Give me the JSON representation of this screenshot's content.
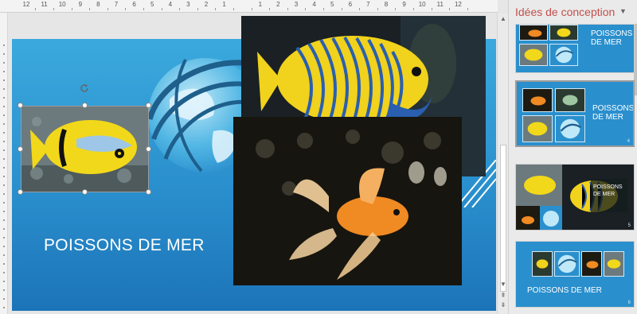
{
  "ruler": {
    "ticks": [
      "12",
      "11",
      "10",
      "9",
      "8",
      "7",
      "6",
      "5",
      "4",
      "3",
      "2",
      "1",
      "",
      "1",
      "2",
      "3",
      "4",
      "5",
      "6",
      "7",
      "8",
      "9",
      "10",
      "11",
      "12"
    ]
  },
  "slide": {
    "title": "POISSONS DE MER",
    "colors": {
      "bg_top": "#3ba9dd",
      "bg_bottom": "#1c74b8",
      "globe": "#1e5f8c"
    }
  },
  "pane": {
    "title": "Idées de conception",
    "menu_icon": "chevron-down-icon",
    "designs": [
      {
        "title": "POISSONS DE MER",
        "number": ""
      },
      {
        "title": "POISSONS DE MER",
        "number": "4"
      },
      {
        "title": "POISSONS DE MER",
        "number": "5"
      },
      {
        "title": "POISSONS DE MER",
        "number": "6"
      }
    ]
  },
  "scrollbar": {
    "up_icon": "▲",
    "down_icon": "▼",
    "page_up_icon": "⇞",
    "page_down_icon": "⇟"
  }
}
